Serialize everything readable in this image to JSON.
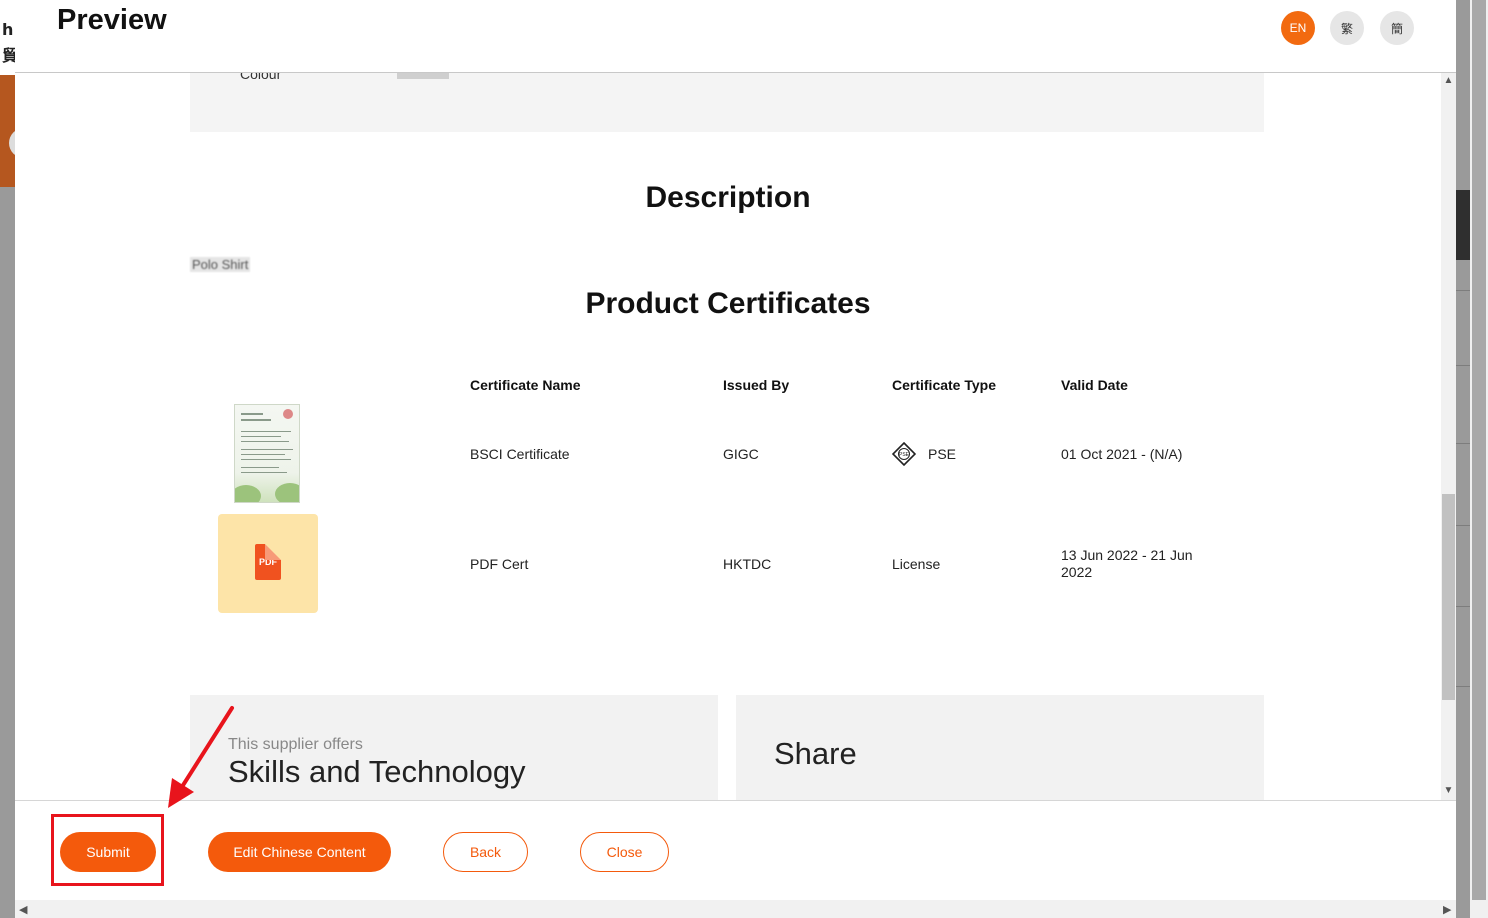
{
  "modal": {
    "title": "Preview",
    "languages": [
      {
        "label": "EN",
        "active": true
      },
      {
        "label": "繁",
        "active": false
      },
      {
        "label": "簡",
        "active": false
      }
    ]
  },
  "specs": {
    "colour_label": "Colour"
  },
  "description": {
    "heading": "Description",
    "text": "Polo Shirt"
  },
  "certificates": {
    "heading": "Product Certificates",
    "columns": [
      "Certificate Name",
      "Issued By",
      "Certificate Type",
      "Valid Date"
    ],
    "rows": [
      {
        "name": "BSCI Certificate",
        "issued_by": "GIGC",
        "type": "PSE",
        "valid": "01 Oct 2021 - (N/A)",
        "thumb": "certificate-image"
      },
      {
        "name": "PDF Cert",
        "issued_by": "HKTDC",
        "type": "License",
        "valid": "13 Jun 2022 - 21 Jun 2022",
        "thumb": "pdf-icon"
      }
    ],
    "pdf_label": "PDF",
    "pse_mark": "PSE"
  },
  "offers": {
    "caption": "This supplier offers",
    "title": "Skills and Technology"
  },
  "share": {
    "title": "Share"
  },
  "footer": {
    "submit_label": "Submit",
    "edit_chinese_label": "Edit Chinese Content",
    "back_label": "Back",
    "close_label": "Close"
  },
  "colors": {
    "accent": "#f45a0c",
    "annotation": "#e8141c"
  },
  "background": {
    "brand_chars": [
      "h",
      "貿"
    ]
  }
}
